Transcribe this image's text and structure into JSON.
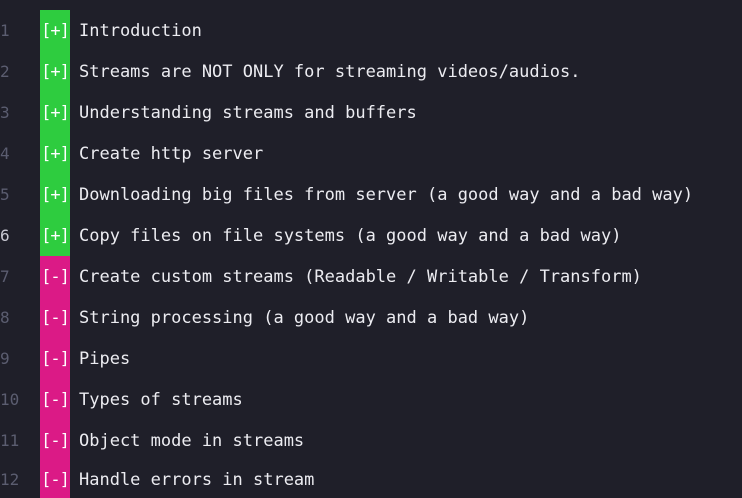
{
  "accent_colors": {
    "done": "#2ecc3f",
    "todo": "#db1a86",
    "background": "#1f1f29"
  },
  "lines": [
    {
      "num": "1",
      "marker": "[+]",
      "status": "done",
      "text": "Introduction"
    },
    {
      "num": "2",
      "marker": "[+]",
      "status": "done",
      "text": "Streams are NOT ONLY for streaming videos/audios."
    },
    {
      "num": "3",
      "marker": "[+]",
      "status": "done",
      "text": "Understanding streams and buffers"
    },
    {
      "num": "4",
      "marker": "[+]",
      "status": "done",
      "text": "Create http server"
    },
    {
      "num": "5",
      "marker": "[+]",
      "status": "done",
      "text": "Downloading big files from server (a good way and a bad way)"
    },
    {
      "num": "6",
      "marker": "[+]",
      "status": "done",
      "text": "Copy files on file systems (a good way and a bad way)"
    },
    {
      "num": "7",
      "marker": "[-]",
      "status": "todo",
      "text": "Create custom streams (Readable / Writable / Transform)"
    },
    {
      "num": "8",
      "marker": "[-]",
      "status": "todo",
      "text": "String processing (a good way and a bad way)"
    },
    {
      "num": "9",
      "marker": "[-]",
      "status": "todo",
      "text": "Pipes"
    },
    {
      "num": "10",
      "marker": "[-]",
      "status": "todo",
      "text": "Types of streams"
    },
    {
      "num": "11",
      "marker": "[-]",
      "status": "todo",
      "text": "Object mode in streams"
    },
    {
      "num": "12",
      "marker": "[-]",
      "status": "todo",
      "text": "Handle errors in stream"
    }
  ]
}
